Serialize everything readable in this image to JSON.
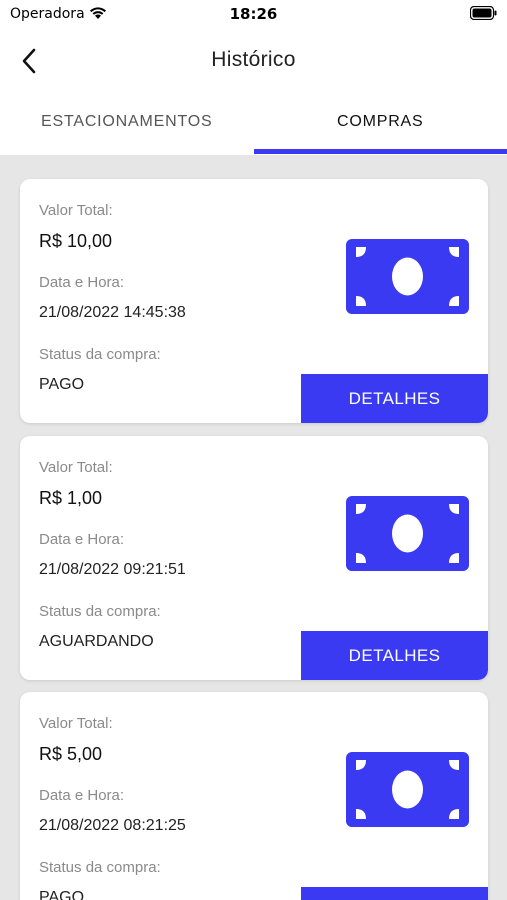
{
  "status_bar": {
    "carrier": "Operadora",
    "time": "18:26"
  },
  "nav": {
    "title": "Histórico"
  },
  "tabs": [
    {
      "label": "ESTACIONAMENTOS",
      "active": false
    },
    {
      "label": "COMPRAS",
      "active": true
    }
  ],
  "colors": {
    "accent": "#3a3af3",
    "background": "#e6e6e6",
    "card": "#ffffff"
  },
  "card_labels": {
    "total": "Valor Total:",
    "datetime": "Data e Hora:",
    "status": "Status da compra:",
    "button": "DETALHES"
  },
  "purchases": [
    {
      "amount": "R$ 10,00",
      "datetime": "21/08/2022 14:45:38",
      "status": "PAGO"
    },
    {
      "amount": "R$ 1,00",
      "datetime": "21/08/2022 09:21:51",
      "status": "AGUARDANDO"
    },
    {
      "amount": "R$ 5,00",
      "datetime": "21/08/2022 08:21:25",
      "status": "PAGO"
    }
  ],
  "icons": {
    "back": "chevron-left-icon",
    "wifi": "wifi-icon",
    "battery": "battery-icon",
    "money": "banknote-icon"
  }
}
